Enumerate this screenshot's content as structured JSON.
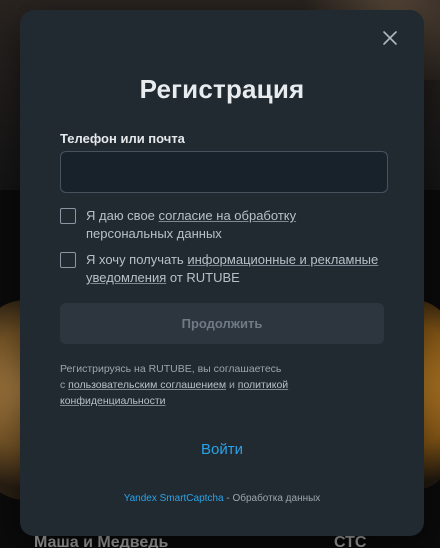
{
  "background": {
    "caption_left": "Маша и Медведь",
    "caption_right": "СТС"
  },
  "modal": {
    "title": "Регистрация",
    "close_icon": "close-icon",
    "field": {
      "label": "Телефон или почта",
      "value": "",
      "placeholder": ""
    },
    "consent_processing": {
      "prefix": "Я даю свое ",
      "link": "согласие на обработку",
      "suffix": " персональных данных",
      "checked": false
    },
    "consent_ads": {
      "prefix": "Я хочу получать ",
      "link": "информационные и рекламные уведомления",
      "suffix": " от RUTUBE",
      "checked": false
    },
    "continue_label": "Продолжить",
    "terms": {
      "line1": "Регистрируясь на RUTUBE, вы соглашаетесь",
      "prefix": "с ",
      "link1": "пользовательским соглашением",
      "middle": " и ",
      "link2": "политикой конфиденциальности"
    },
    "login_label": "Войти",
    "captcha": {
      "brand": "Yandex SmartCaptcha",
      "separator": " - ",
      "text": "Обработка данных"
    }
  },
  "colors": {
    "modal_bg": "#222a31",
    "accent": "#29a3e8",
    "button_disabled_bg": "#2d363f"
  }
}
